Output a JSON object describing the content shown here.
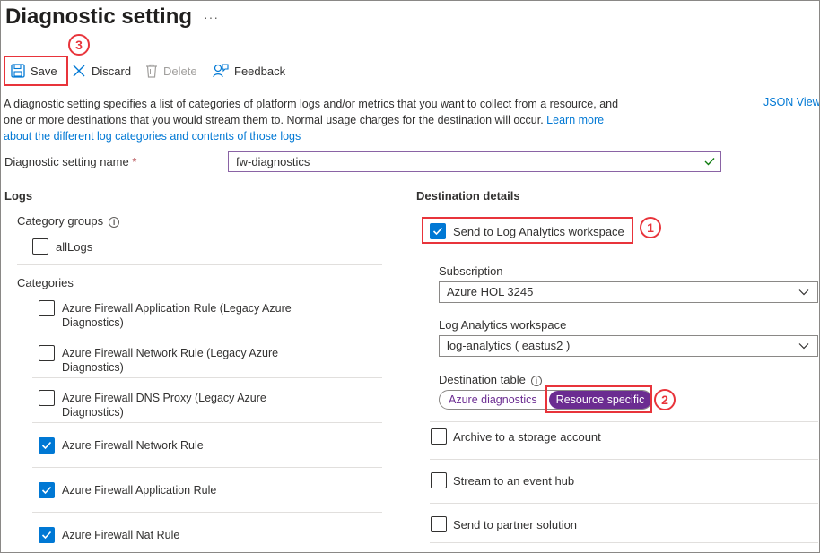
{
  "header": {
    "title": "Diagnostic setting",
    "more_label": "···"
  },
  "toolbar": {
    "save_label": "Save",
    "discard_label": "Discard",
    "delete_label": "Delete",
    "feedback_label": "Feedback"
  },
  "description": {
    "text": "A diagnostic setting specifies a list of categories of platform logs and/or metrics that you want to collect from a resource, and one or more destinations that you would stream them to. Normal usage charges for the destination will occur. ",
    "link_text": "Learn more about the different log categories and contents of those logs"
  },
  "json_view_label": "JSON View",
  "setting_name": {
    "label": "Diagnostic setting name",
    "required_mark": "*",
    "value": "fw-diagnostics"
  },
  "logs": {
    "heading": "Logs",
    "category_groups_label": "Category groups",
    "category_groups": [
      {
        "label": "allLogs",
        "checked": false
      }
    ],
    "categories_label": "Categories",
    "categories": [
      {
        "label": "Azure Firewall Application Rule (Legacy Azure Diagnostics)",
        "checked": false
      },
      {
        "label": "Azure Firewall Network Rule (Legacy Azure Diagnostics)",
        "checked": false
      },
      {
        "label": "Azure Firewall DNS Proxy (Legacy Azure Diagnostics)",
        "checked": false
      },
      {
        "label": "Azure Firewall Network Rule",
        "checked": true
      },
      {
        "label": "Azure Firewall Application Rule",
        "checked": true
      },
      {
        "label": "Azure Firewall Nat Rule",
        "checked": true
      }
    ]
  },
  "destination": {
    "heading": "Destination details",
    "log_analytics_label": "Send to Log Analytics workspace",
    "log_analytics_checked": true,
    "subscription_label": "Subscription",
    "subscription_value": "Azure HOL 3245",
    "workspace_label": "Log Analytics workspace",
    "workspace_value": "log-analytics ( eastus2 )",
    "table_label": "Destination table",
    "table_options": [
      "Azure diagnostics",
      "Resource specific"
    ],
    "table_selected": "Resource specific",
    "archive_label": "Archive to a storage account",
    "eventhub_label": "Stream to an event hub",
    "partner_label": "Send to partner solution"
  },
  "annotations": {
    "step1": "1",
    "step2": "2",
    "step3": "3"
  },
  "colors": {
    "accent_blue": "#0078d4",
    "highlight_red": "#e8343b",
    "pill_purple": "#6b2c91",
    "valid_green": "#107c10"
  }
}
